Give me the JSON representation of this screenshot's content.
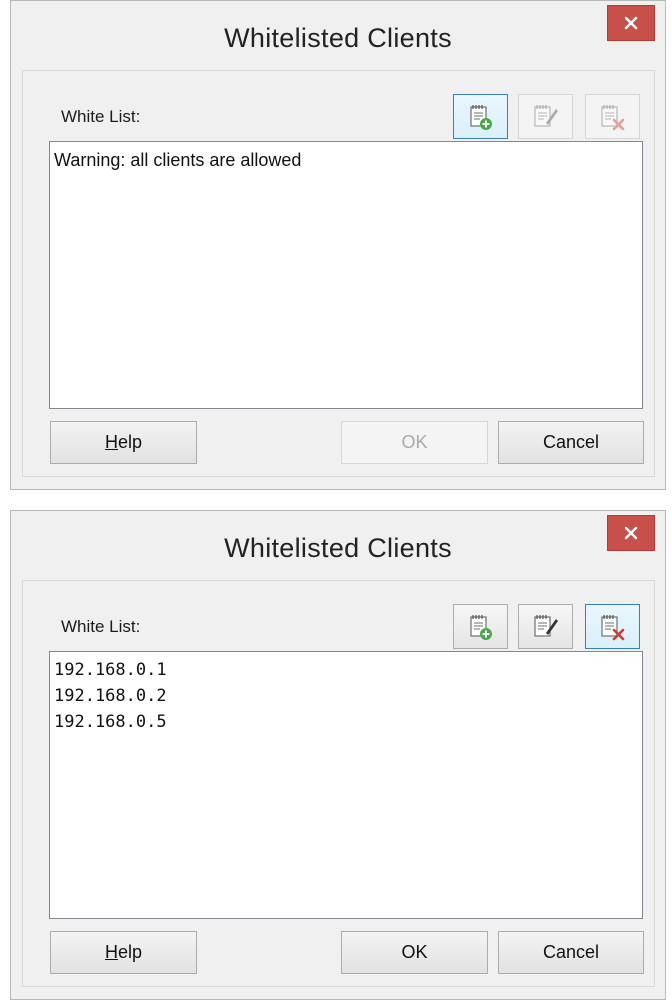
{
  "dialogs": [
    {
      "title": "Whitelisted Clients",
      "list_label": "White List:",
      "list_items": [
        "Warning: all clients are allowed"
      ],
      "toolbar": {
        "add_enabled": true,
        "edit_enabled": false,
        "delete_enabled": false,
        "focused": "add"
      },
      "buttons": {
        "help_mnemonic": "H",
        "help_rest": "elp",
        "ok": "OK",
        "ok_enabled": false,
        "cancel": "Cancel"
      }
    },
    {
      "title": "Whitelisted Clients",
      "list_label": "White List:",
      "list_items": [
        "192.168.0.1",
        "192.168.0.2",
        "192.168.0.5"
      ],
      "toolbar": {
        "add_enabled": true,
        "edit_enabled": true,
        "delete_enabled": true,
        "focused": "delete"
      },
      "buttons": {
        "help_mnemonic": "H",
        "help_rest": "elp",
        "ok": "OK",
        "ok_enabled": true,
        "cancel": "Cancel"
      }
    }
  ],
  "icons": {
    "close": "close-icon",
    "add": "add-entry-icon",
    "edit": "edit-entry-icon",
    "delete": "delete-entry-icon"
  },
  "colors": {
    "close_button": "#c7504a",
    "dialog_background": "#f0f0f0",
    "focus_border": "#3c7fb1",
    "disabled_text": "#a9a9a9"
  }
}
